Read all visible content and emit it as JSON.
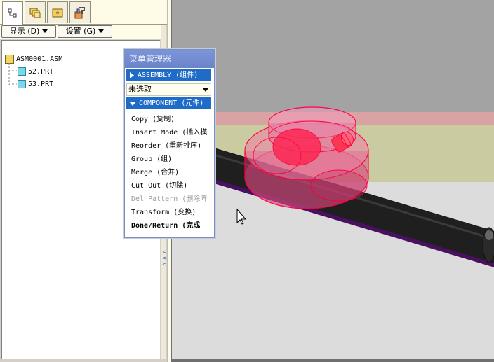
{
  "nav_tabs": [
    {
      "name": "model-tree-tab",
      "icon": "tree-icon"
    },
    {
      "name": "folder-browser-tab",
      "icon": "folders-icon"
    },
    {
      "name": "favorites-tab",
      "icon": "star-folder-icon"
    },
    {
      "name": "connections-tab",
      "icon": "tools-icon"
    }
  ],
  "toolbar": {
    "display_label": "显示 (D)",
    "settings_label": "设置 (G)"
  },
  "tree": {
    "root": "ASM0001.ASM",
    "children": [
      "52.PRT",
      "53.PRT"
    ]
  },
  "menu_manager": {
    "title": "菜单管理器",
    "assembly_label": "ASSEMBLY (组件)",
    "selection_value": "未选取",
    "component_label": "COMPONENT (元件)",
    "items": [
      {
        "label": "Copy (复制)",
        "state": "normal"
      },
      {
        "label": "Insert Mode (插入模",
        "state": "normal"
      },
      {
        "label": "Reorder (重新排序)",
        "state": "normal"
      },
      {
        "label": "Group (组)",
        "state": "normal"
      },
      {
        "label": "Merge (合并)",
        "state": "normal"
      },
      {
        "label": "Cut Out (切除)",
        "state": "normal"
      },
      {
        "label": "Del Pattern (删除阵",
        "state": "disabled"
      },
      {
        "label": "Transform (变换)",
        "state": "normal"
      },
      {
        "label": "Done/Return (完成",
        "state": "bold"
      }
    ]
  },
  "colors": {
    "menu_title": "#6b84c8",
    "menu_section": "#1f6cc8",
    "highlight_part": "#ff2050",
    "shaft": "#202020"
  }
}
